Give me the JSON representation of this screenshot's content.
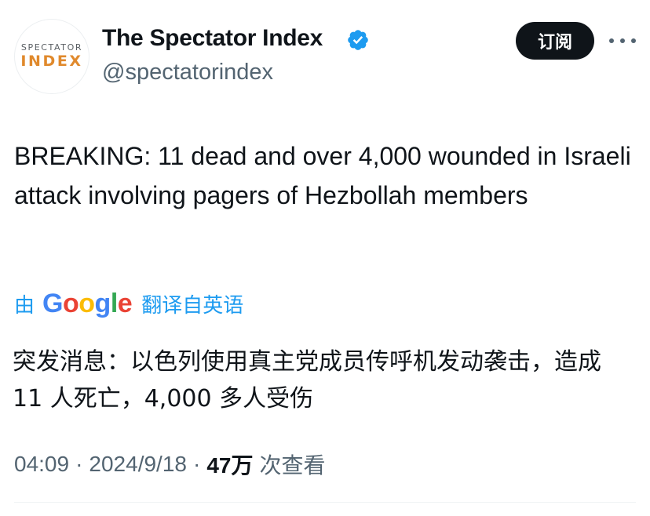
{
  "author": {
    "avatar_line1": "SPECTATOR",
    "avatar_line2": "INDEX",
    "name": "The Spectator Index",
    "handle": "@spectatorindex",
    "verified_icon": "verified-badge-icon"
  },
  "actions": {
    "subscribe_label": "订阅",
    "more_icon": "more-options-icon"
  },
  "tweet": {
    "text": "BREAKING: 11 dead and over 4,000 wounded in Israeli attack involving pagers of Hezbollah members"
  },
  "translation": {
    "by_label": "由",
    "provider": "Google",
    "action_label": "翻译自英语",
    "text": "突发消息：以色列使用真主党成员传呼机发动袭击，造成 11 人死亡，4,000 多人受伤"
  },
  "meta": {
    "time": "04:09",
    "date": "2024/9/18",
    "views_count": "47万",
    "views_label": "次查看",
    "separator": "·"
  },
  "colors": {
    "accent": "#1d9bf0",
    "text_primary": "#0f1419",
    "text_secondary": "#536471",
    "brand_orange": "#e0892c"
  }
}
